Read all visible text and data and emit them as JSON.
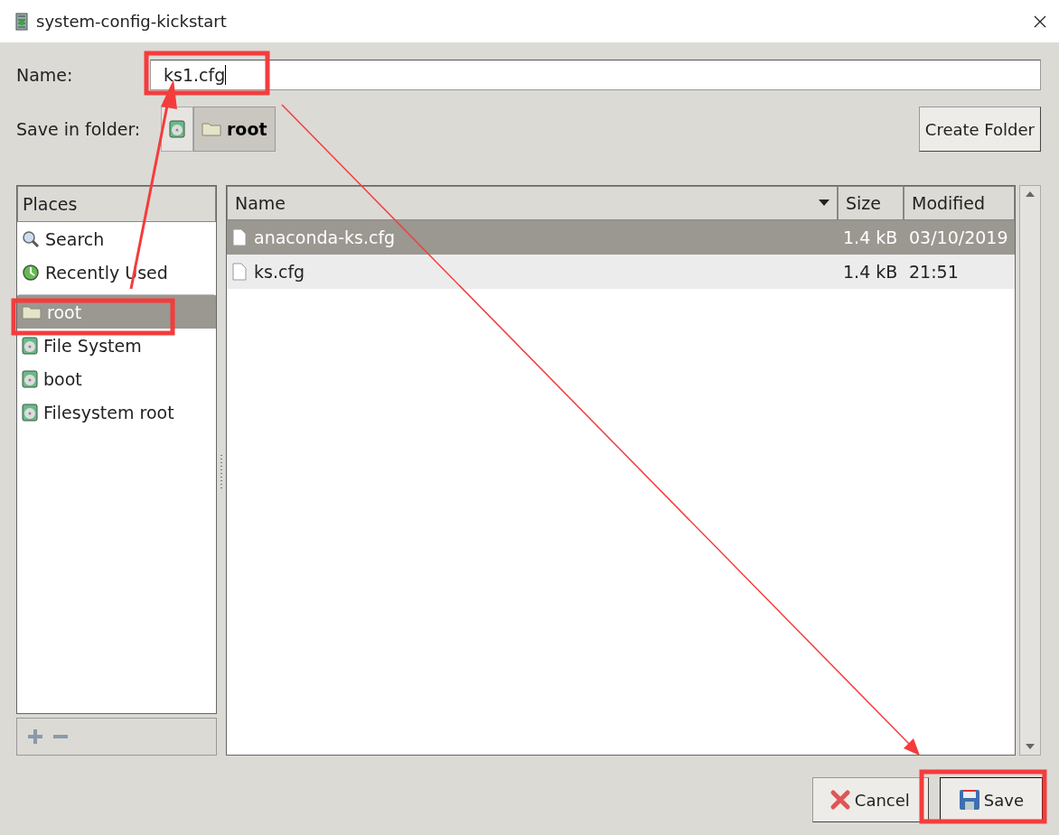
{
  "window": {
    "title": "system-config-kickstart"
  },
  "name_field": {
    "label": "Name:",
    "value": "ks1.cfg"
  },
  "save_in": {
    "label": "Save in folder:",
    "path": [
      {
        "kind": "drive"
      },
      {
        "kind": "folder",
        "label": "root"
      }
    ],
    "create_button": "Create Folder"
  },
  "places": {
    "header": "Places",
    "groups": [
      [
        {
          "kind": "search",
          "label": "Search",
          "selected": false
        },
        {
          "kind": "recent",
          "label": "Recently Used",
          "selected": false
        }
      ],
      [
        {
          "kind": "folder",
          "label": "root",
          "selected": true
        },
        {
          "kind": "drive",
          "label": "File System",
          "selected": false
        },
        {
          "kind": "drive",
          "label": "boot",
          "selected": false
        },
        {
          "kind": "drive",
          "label": "Filesystem root",
          "selected": false
        }
      ]
    ]
  },
  "files": {
    "columns": [
      "Name",
      "Size",
      "Modified"
    ],
    "rows": [
      {
        "name": "anaconda-ks.cfg",
        "size": "1.4 kB",
        "modified": "03/10/2019",
        "selected": true
      },
      {
        "name": "ks.cfg",
        "size": "1.4 kB",
        "modified": "21:51",
        "selected": false
      }
    ]
  },
  "buttons": [
    {
      "kind": "cancel",
      "label": "Cancel"
    },
    {
      "kind": "save",
      "label": "Save"
    }
  ]
}
